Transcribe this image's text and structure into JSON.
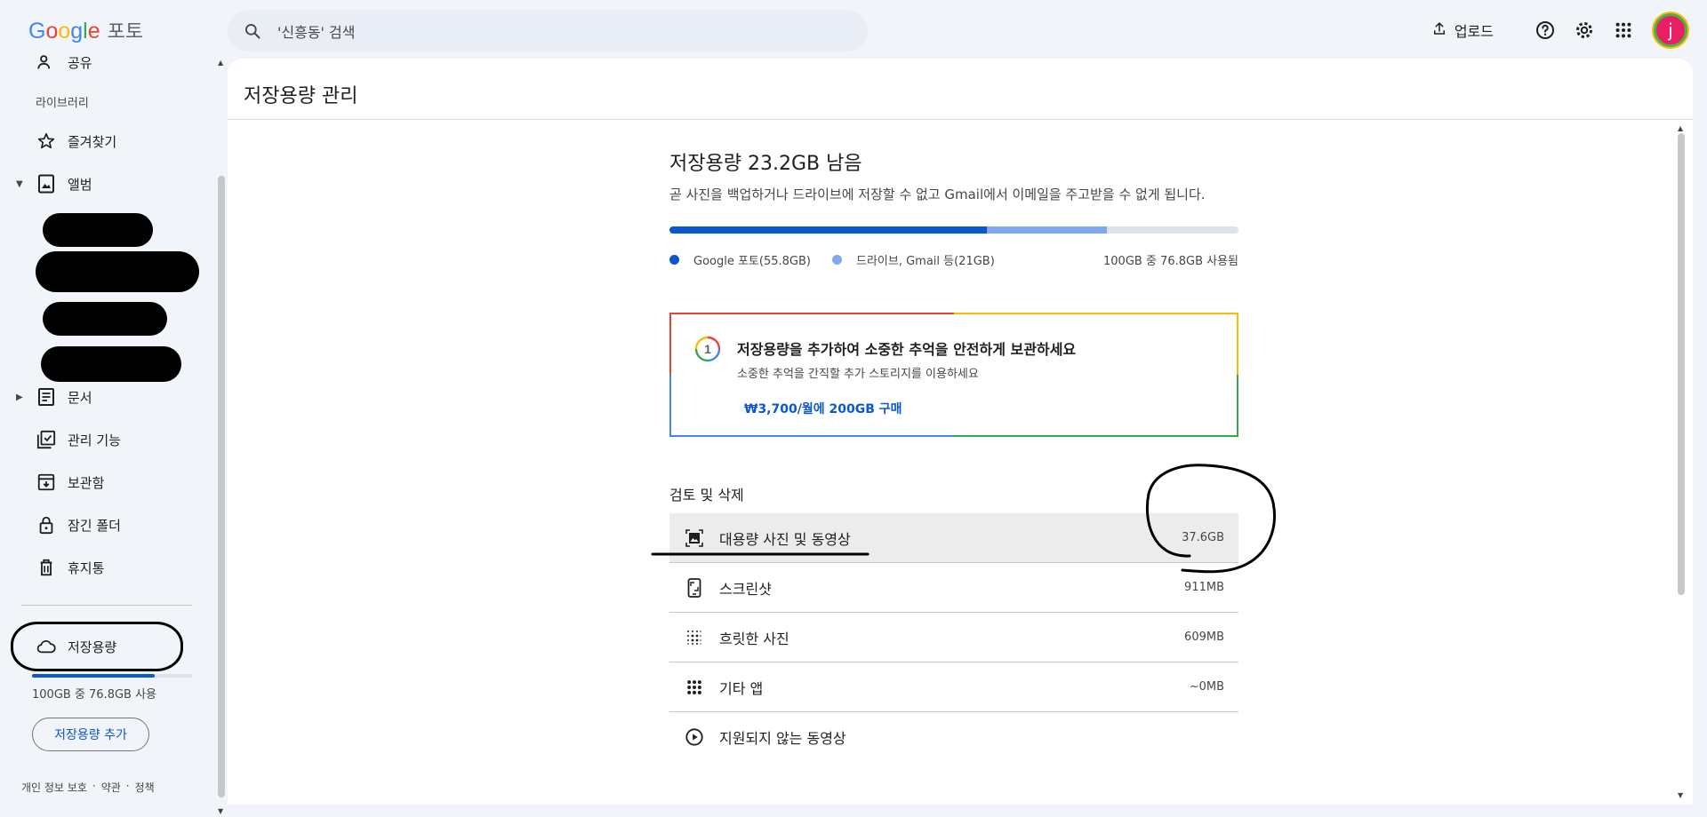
{
  "app": {
    "logo_letters": [
      "G",
      "o",
      "o",
      "g",
      "l",
      "e"
    ],
    "product": "포토"
  },
  "search": {
    "placeholder": "'신흥동' 검색"
  },
  "top_actions": {
    "upload_label": "업로드",
    "avatar_initial": "j"
  },
  "sidebar": {
    "sharing_label": "공유",
    "library_section": "라이브러리",
    "favorites_label": "즐겨찾기",
    "albums_label": "앨범",
    "documents_label": "문서",
    "utilities_label": "관리 기능",
    "archive_label": "보관함",
    "locked_folder_label": "잠긴 폴더",
    "trash_label": "휴지통",
    "storage_label": "저장용량",
    "storage_usage_text": "100GB 중 76.8GB 사용",
    "storage_used_fraction": 0.768,
    "add_storage_label": "저장용량 추가",
    "footer": [
      "개인 정보 보호",
      "·",
      "약관",
      "·",
      "정책"
    ]
  },
  "main": {
    "title": "저장용량 관리",
    "storage_remaining": "저장용량 23.2GB 남음",
    "storage_warning": "곧 사진을 백업하거나 드라이브에 저장할 수 없고 Gmail에서 이메일을 주고받을 수 없게 됩니다.",
    "usage": {
      "photos_label": "Google 포토(55.8GB)",
      "photos_gb": 55.8,
      "other_label": "드라이브, Gmail 등(21GB)",
      "other_gb": 21,
      "total_label": "100GB 중 76.8GB 사용됨",
      "photos_color": "#0b57d0",
      "other_color": "#7fa8f0"
    },
    "promo": {
      "badge_number": "1",
      "title": "저장용량을 추가하여 소중한 추억을 안전하게 보관하세요",
      "subtitle": "소중한 추억을 간직할 추가 스토리지를 이용하세요",
      "link": "₩3,700/월에 200GB 구매"
    },
    "review": {
      "title": "검토 및 삭제",
      "items": [
        {
          "label": "대용량 사진 및 동영상",
          "size": "37.6GB",
          "icon": "large-photo-icon"
        },
        {
          "label": "스크린샷",
          "size": "911MB",
          "icon": "phone-screenshot-icon"
        },
        {
          "label": "흐릿한 사진",
          "size": "609MB",
          "icon": "blur-icon"
        },
        {
          "label": "기타 앱",
          "size": "~0MB",
          "icon": "apps-grid-icon"
        },
        {
          "label": "지원되지 않는 동영상",
          "size": "",
          "icon": "play-circle-icon"
        }
      ]
    }
  }
}
